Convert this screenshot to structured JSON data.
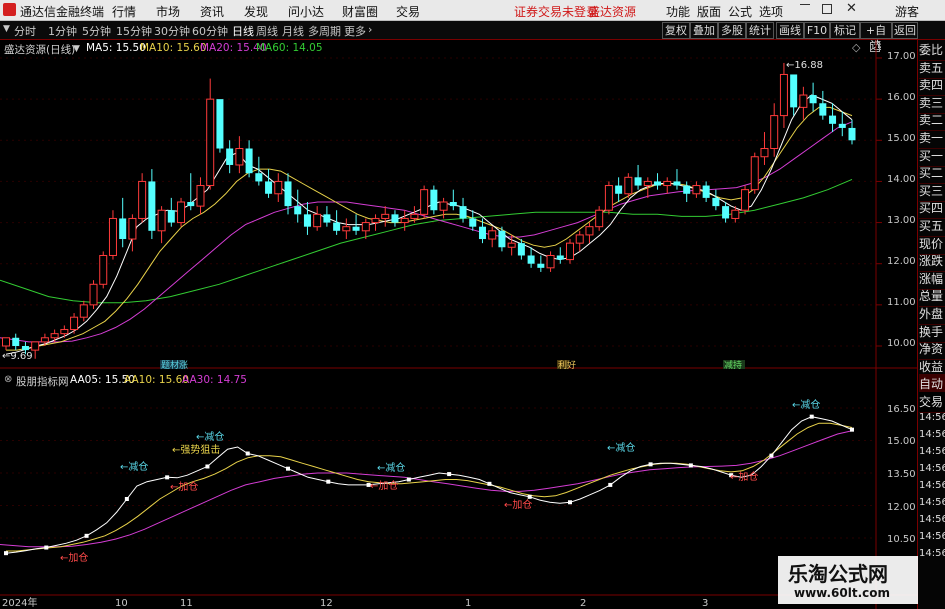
{
  "window": {
    "app_title": "通达信金融终端",
    "menus": [
      "行情",
      "市场",
      "资讯",
      "发现",
      "问小达",
      "财富圈",
      "交易"
    ],
    "notice": "证券交易未登录",
    "stock_red": "盛达资源",
    "right_menus": [
      "功能",
      "版面",
      "公式",
      "选项"
    ],
    "user": "游客"
  },
  "toolbar": {
    "periods": [
      "分时",
      "1分钟",
      "5分钟",
      "15分钟",
      "30分钟",
      "60分钟",
      "日线",
      "周线",
      "月线",
      "多周期",
      "更多"
    ],
    "active_period": "日线",
    "buttons": [
      "复权",
      "叠加",
      "多股",
      "统计",
      "画线",
      "F10",
      "标记",
      "+自选",
      "返回"
    ]
  },
  "main_chart": {
    "title": "盛达资源(日线)",
    "ma": [
      {
        "label": "MA5: 15.50",
        "color": "#ffffff"
      },
      {
        "label": "MA10: 15.60",
        "color": "#e8d24a"
      },
      {
        "label": "MA20: 15.40",
        "color": "#d43dd4"
      },
      {
        "label": "MA60: 14.05",
        "color": "#33cc33"
      }
    ],
    "y_ticks": [
      "17.00",
      "16.00",
      "15.00",
      "14.00",
      "13.00",
      "12.00",
      "11.00",
      "10.00"
    ],
    "high_label": "16.88",
    "low_label": "9.69",
    "events": [
      "题材涨",
      "利好",
      "减持"
    ]
  },
  "indicator": {
    "title": "股朋指标网",
    "lines": [
      {
        "label": "AA05: 15.50",
        "color": "#ffffff"
      },
      {
        "label": "AA10: 15.60",
        "color": "#e8d24a"
      },
      {
        "label": "AA30: 14.75",
        "color": "#d43dd4"
      }
    ],
    "y_ticks": [
      "16.50",
      "15.00",
      "13.50",
      "12.00",
      "10.50"
    ],
    "annotations": {
      "reduce": "←减仓",
      "add": "←加仓",
      "strong": "←强势狙击"
    }
  },
  "x_axis": {
    "labels": [
      "2024年",
      "10",
      "11",
      "12",
      "1",
      "2",
      "3"
    ]
  },
  "right_panel": {
    "items": [
      "委比",
      "卖五",
      "卖四",
      "卖三",
      "卖二",
      "卖一",
      "买一",
      "买二",
      "买三",
      "买四",
      "买五",
      "现价",
      "涨跌",
      "涨幅",
      "总量",
      "外盘",
      "换手",
      "净资",
      "收益"
    ],
    "tabs": [
      "自动",
      "交易"
    ],
    "times": [
      "14:56",
      "14:56",
      "14:56",
      "14:56",
      "14:56",
      "14:56",
      "14:56",
      "14:56",
      "14:56"
    ]
  },
  "watermark": {
    "title": "乐淘公式网",
    "url": "www.60lt.com"
  },
  "chart_data": {
    "type": "candlestick",
    "symbol": "盛达资源",
    "period": "日线",
    "ylim": [
      9.6,
      17.3
    ],
    "candles": [
      [
        10.0,
        10.2,
        9.9,
        10.2
      ],
      [
        10.2,
        10.3,
        9.9,
        10.0
      ],
      [
        10.0,
        10.1,
        9.8,
        9.9
      ],
      [
        9.9,
        10.1,
        9.69,
        10.1
      ],
      [
        10.1,
        10.3,
        10.0,
        10.2
      ],
      [
        10.2,
        10.4,
        10.1,
        10.3
      ],
      [
        10.3,
        10.5,
        10.2,
        10.4
      ],
      [
        10.4,
        10.8,
        10.3,
        10.7
      ],
      [
        10.7,
        11.1,
        10.6,
        11.0
      ],
      [
        11.0,
        11.6,
        10.9,
        11.5
      ],
      [
        11.5,
        12.3,
        11.4,
        12.2
      ],
      [
        12.2,
        13.3,
        12.1,
        13.1
      ],
      [
        13.1,
        13.6,
        12.4,
        12.6
      ],
      [
        12.6,
        13.2,
        12.3,
        13.1
      ],
      [
        13.1,
        14.2,
        13.0,
        14.0
      ],
      [
        14.0,
        14.3,
        12.6,
        12.8
      ],
      [
        12.8,
        13.4,
        12.5,
        13.3
      ],
      [
        13.3,
        13.6,
        12.9,
        13.0
      ],
      [
        13.0,
        13.6,
        12.9,
        13.5
      ],
      [
        13.5,
        14.2,
        13.3,
        13.4
      ],
      [
        13.4,
        14.1,
        13.2,
        13.9
      ],
      [
        13.9,
        16.5,
        13.8,
        16.0
      ],
      [
        16.0,
        15.3,
        14.7,
        14.8
      ],
      [
        14.8,
        15.0,
        14.2,
        14.4
      ],
      [
        14.4,
        15.1,
        14.2,
        14.8
      ],
      [
        14.8,
        15.0,
        14.1,
        14.2
      ],
      [
        14.2,
        14.6,
        13.9,
        14.0
      ],
      [
        14.0,
        14.3,
        13.6,
        13.7
      ],
      [
        13.7,
        14.2,
        13.5,
        14.0
      ],
      [
        14.0,
        14.2,
        13.2,
        13.4
      ],
      [
        13.4,
        13.8,
        13.0,
        13.2
      ],
      [
        13.2,
        13.5,
        12.7,
        12.9
      ],
      [
        12.9,
        13.4,
        12.8,
        13.2
      ],
      [
        13.2,
        13.4,
        12.9,
        13.0
      ],
      [
        13.0,
        13.3,
        12.7,
        12.8
      ],
      [
        12.8,
        13.1,
        12.6,
        12.9
      ],
      [
        12.9,
        13.2,
        12.7,
        12.8
      ],
      [
        12.8,
        13.1,
        12.6,
        13.0
      ],
      [
        13.0,
        13.2,
        12.8,
        13.1
      ],
      [
        13.1,
        13.4,
        12.9,
        13.2
      ],
      [
        13.2,
        13.3,
        12.9,
        13.0
      ],
      [
        13.0,
        13.3,
        12.8,
        13.1
      ],
      [
        13.1,
        13.4,
        13.0,
        13.2
      ],
      [
        13.2,
        13.9,
        13.1,
        13.8
      ],
      [
        13.8,
        13.9,
        13.2,
        13.3
      ],
      [
        13.3,
        13.6,
        13.1,
        13.5
      ],
      [
        13.5,
        13.8,
        13.3,
        13.4
      ],
      [
        13.4,
        13.6,
        13.0,
        13.1
      ],
      [
        13.1,
        13.3,
        12.8,
        12.9
      ],
      [
        12.9,
        13.1,
        12.5,
        12.6
      ],
      [
        12.6,
        12.9,
        12.4,
        12.8
      ],
      [
        12.8,
        12.9,
        12.3,
        12.4
      ],
      [
        12.4,
        12.7,
        12.2,
        12.5
      ],
      [
        12.5,
        12.6,
        12.1,
        12.2
      ],
      [
        12.2,
        12.4,
        11.9,
        12.0
      ],
      [
        12.0,
        12.2,
        11.8,
        11.9
      ],
      [
        11.9,
        12.3,
        11.8,
        12.2
      ],
      [
        12.2,
        12.4,
        12.0,
        12.1
      ],
      [
        12.1,
        12.6,
        12.0,
        12.5
      ],
      [
        12.5,
        12.8,
        12.3,
        12.7
      ],
      [
        12.7,
        13.0,
        12.5,
        12.9
      ],
      [
        12.9,
        13.4,
        12.8,
        13.3
      ],
      [
        13.3,
        14.0,
        13.2,
        13.9
      ],
      [
        13.9,
        14.1,
        13.5,
        13.7
      ],
      [
        13.7,
        14.2,
        13.6,
        14.1
      ],
      [
        14.1,
        14.4,
        13.8,
        13.9
      ],
      [
        13.9,
        14.1,
        13.6,
        14.0
      ],
      [
        14.0,
        14.2,
        13.8,
        13.9
      ],
      [
        13.9,
        14.1,
        13.7,
        14.0
      ],
      [
        14.0,
        14.3,
        13.8,
        13.9
      ],
      [
        13.9,
        14.0,
        13.5,
        13.7
      ],
      [
        13.7,
        14.0,
        13.6,
        13.9
      ],
      [
        13.9,
        14.0,
        13.5,
        13.6
      ],
      [
        13.6,
        13.8,
        13.3,
        13.4
      ],
      [
        13.4,
        13.5,
        13.0,
        13.1
      ],
      [
        13.1,
        13.4,
        13.0,
        13.3
      ],
      [
        13.3,
        13.9,
        13.2,
        13.8
      ],
      [
        13.8,
        14.7,
        13.7,
        14.6
      ],
      [
        14.6,
        15.2,
        14.4,
        14.8
      ],
      [
        14.8,
        15.9,
        14.6,
        15.6
      ],
      [
        15.6,
        16.88,
        15.3,
        16.6
      ],
      [
        16.6,
        16.5,
        15.6,
        15.8
      ],
      [
        15.8,
        16.3,
        15.5,
        16.1
      ],
      [
        16.1,
        16.4,
        15.7,
        15.9
      ],
      [
        15.9,
        16.2,
        15.5,
        15.6
      ],
      [
        15.6,
        15.9,
        15.2,
        15.4
      ],
      [
        15.4,
        15.7,
        15.1,
        15.3
      ],
      [
        15.3,
        15.5,
        14.9,
        15.0
      ]
    ],
    "ma5": [
      9.8,
      9.85,
      9.92,
      10.0,
      10.06,
      10.16,
      10.26,
      10.4,
      10.6,
      10.88,
      11.2,
      11.7,
      12.3,
      12.9,
      13.1,
      13.2,
      13.3,
      13.28,
      13.4,
      13.6,
      13.8,
      14.2,
      14.6,
      14.7,
      14.4,
      14.3,
      14.1,
      13.9,
      13.7,
      13.5,
      13.3,
      13.2,
      13.1,
      13.0,
      12.95,
      12.95,
      12.95,
      13.0,
      13.05,
      13.1,
      13.2,
      13.3,
      13.4,
      13.5,
      13.45,
      13.4,
      13.3,
      13.2,
      13.0,
      12.8,
      12.6,
      12.5,
      12.4,
      12.25,
      12.15,
      12.1,
      12.15,
      12.3,
      12.5,
      12.7,
      12.95,
      13.3,
      13.6,
      13.8,
      13.9,
      13.95,
      13.95,
      13.9,
      13.85,
      13.8,
      13.7,
      13.55,
      13.4,
      13.3,
      13.4,
      13.8,
      14.3,
      14.9,
      15.5,
      15.9,
      16.1,
      16.0,
      15.9,
      15.7,
      15.5
    ],
    "ma10": [
      9.9,
      9.9,
      9.95,
      10.0,
      10.05,
      10.1,
      10.2,
      10.3,
      10.45,
      10.6,
      10.85,
      11.15,
      11.5,
      11.9,
      12.3,
      12.6,
      12.9,
      13.1,
      13.25,
      13.45,
      13.7,
      14.0,
      14.2,
      14.3,
      14.3,
      14.25,
      14.1,
      13.95,
      13.8,
      13.65,
      13.5,
      13.35,
      13.2,
      13.1,
      13.05,
      13.0,
      13.0,
      13.05,
      13.1,
      13.15,
      13.2,
      13.2,
      13.15,
      13.05,
      12.95,
      12.85,
      12.7,
      12.55,
      12.45,
      12.4,
      12.45,
      12.6,
      12.8,
      13.0,
      13.2,
      13.4,
      13.55,
      13.7,
      13.8,
      13.9,
      13.95,
      13.95,
      13.9,
      13.8,
      13.7,
      13.6,
      13.55,
      13.6,
      13.8,
      14.1,
      14.5,
      14.9,
      15.3,
      15.6,
      15.8,
      15.8,
      15.7,
      15.6
    ],
    "ma20": [
      10.2,
      10.15,
      10.1,
      10.1,
      10.1,
      10.12,
      10.2,
      10.3,
      10.45,
      10.65,
      10.9,
      11.2,
      11.5,
      11.8,
      12.1,
      12.4,
      12.7,
      12.95,
      13.1,
      13.25,
      13.35,
      13.45,
      13.5,
      13.5,
      13.5,
      13.45,
      13.4,
      13.35,
      13.3,
      13.2,
      13.1,
      13.0,
      12.9,
      12.8,
      12.7,
      12.65,
      12.65,
      12.7,
      12.8,
      12.9,
      13.0,
      13.15,
      13.3,
      13.45,
      13.55,
      13.65,
      13.7,
      13.75,
      13.78,
      13.8,
      13.82,
      13.85,
      13.95,
      14.1,
      14.3,
      14.55,
      14.8,
      15.05,
      15.3,
      15.45
    ],
    "ma60": [
      11.6,
      11.4,
      11.2,
      11.1,
      11.05,
      11.05,
      11.1,
      11.2,
      11.35,
      11.5,
      11.7,
      11.9,
      12.1,
      12.3,
      12.5,
      12.65,
      12.8,
      12.95,
      13.05,
      13.1,
      13.15,
      13.2,
      13.25,
      13.25,
      13.25,
      13.25,
      13.2,
      13.2,
      13.15,
      13.15,
      13.2,
      13.3,
      13.45,
      13.6,
      13.8,
      14.05
    ]
  }
}
